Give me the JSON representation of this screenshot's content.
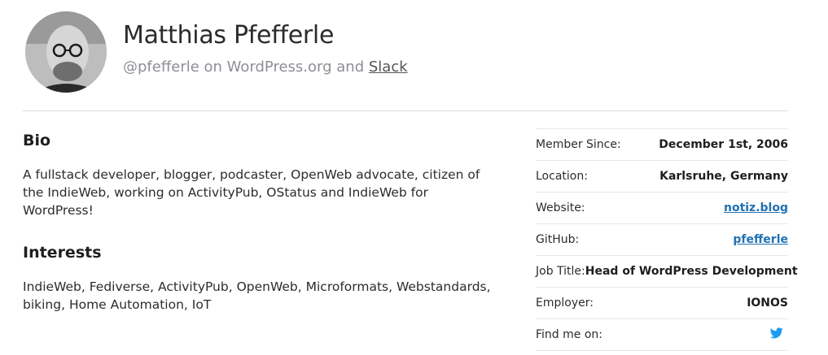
{
  "profile": {
    "name": "Matthias Pfefferle",
    "handle_text": "@pfefferle on WordPress.org and",
    "slack_label": "Slack"
  },
  "bio": {
    "title": "Bio",
    "text": "A fullstack developer, blogger, podcaster, OpenWeb advocate, citizen of the IndieWeb, working on ActivityPub, OStatus and IndieWeb for WordPress!"
  },
  "interests": {
    "title": "Interests",
    "text": "IndieWeb, Fediverse, ActivityPub, OpenWeb, Microformats, Webstandards, biking, Home Automation, IoT"
  },
  "meta": {
    "member_since": {
      "label": "Member Since:",
      "value": "December 1st, 2006"
    },
    "location": {
      "label": "Location:",
      "value": "Karlsruhe, Germany"
    },
    "website": {
      "label": "Website:",
      "value": "notiz.blog"
    },
    "github": {
      "label": "GitHub:",
      "value": "pfefferle"
    },
    "job_title": {
      "label": "Job Title:",
      "value": "Head of WordPress Development"
    },
    "employer": {
      "label": "Employer:",
      "value": "IONOS"
    },
    "find_me": {
      "label": "Find me on:",
      "icon": "twitter-icon"
    }
  },
  "colors": {
    "link": "#2271b1",
    "twitter": "#1d9bf0"
  }
}
